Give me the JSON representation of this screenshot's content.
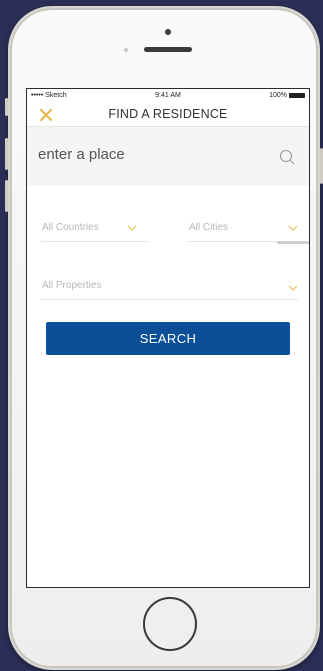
{
  "status_bar": {
    "carrier": "••••• Sketch",
    "time": "9:41 AM",
    "battery": "100%"
  },
  "nav": {
    "title": "FIND A RESIDENCE",
    "close_icon": "close-icon"
  },
  "search": {
    "placeholder": "enter a place",
    "icon": "search-icon"
  },
  "filters": {
    "countries": "All Countries",
    "cities": "All Cities",
    "properties": "All Properties",
    "chevron_icon": "chevron-down-icon"
  },
  "search_button": {
    "label": "SEARCH"
  },
  "colors": {
    "accent": "#e6b547",
    "primary": "#0c4f99",
    "background": "#2b2f56"
  }
}
